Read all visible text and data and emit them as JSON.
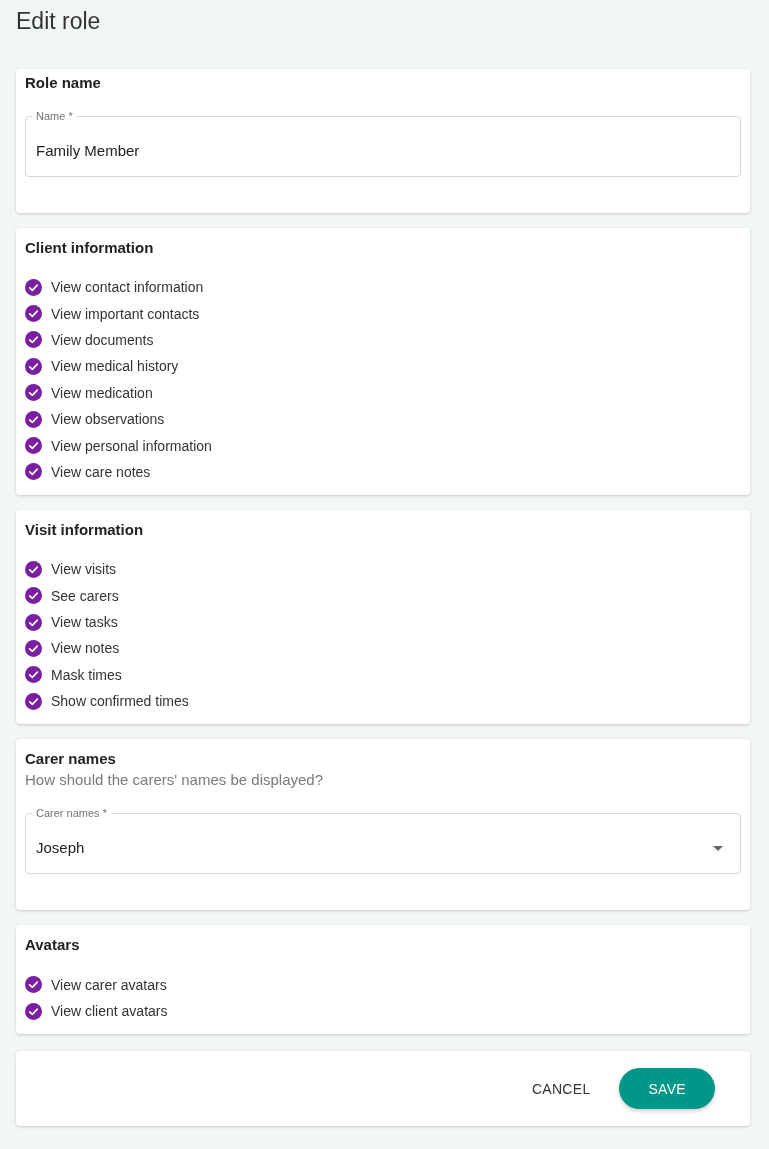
{
  "page": {
    "title": "Edit role"
  },
  "sections": [
    {
      "kind": "field",
      "title": "Role name",
      "field": {
        "label": "Name *",
        "value": "Family Member"
      }
    },
    {
      "kind": "checklist",
      "title": "Client information",
      "items": [
        {
          "label": "View contact information",
          "checked": true
        },
        {
          "label": "View important contacts",
          "checked": true
        },
        {
          "label": "View documents",
          "checked": true
        },
        {
          "label": "View medical history",
          "checked": true
        },
        {
          "label": "View medication",
          "checked": true
        },
        {
          "label": "View observations",
          "checked": true
        },
        {
          "label": "View personal information",
          "checked": true
        },
        {
          "label": "View care notes",
          "checked": true
        }
      ]
    },
    {
      "kind": "checklist",
      "title": "Visit information",
      "items": [
        {
          "label": "View visits",
          "checked": true
        },
        {
          "label": "See carers",
          "checked": true
        },
        {
          "label": "View tasks",
          "checked": true
        },
        {
          "label": "View notes",
          "checked": true
        },
        {
          "label": "Mask times",
          "checked": true
        },
        {
          "label": "Show confirmed times",
          "checked": true
        }
      ]
    },
    {
      "kind": "select",
      "title": "Carer names",
      "subtitle": "How should the carers' names be displayed?",
      "field": {
        "label": "Carer names *",
        "value": "Joseph"
      }
    },
    {
      "kind": "checklist",
      "title": "Avatars",
      "items": [
        {
          "label": "View carer avatars",
          "checked": true
        },
        {
          "label": "View client avatars",
          "checked": true
        }
      ]
    }
  ],
  "actions": [
    {
      "kind": "cancel",
      "label": "CANCEL"
    },
    {
      "kind": "save",
      "label": "SAVE"
    }
  ]
}
